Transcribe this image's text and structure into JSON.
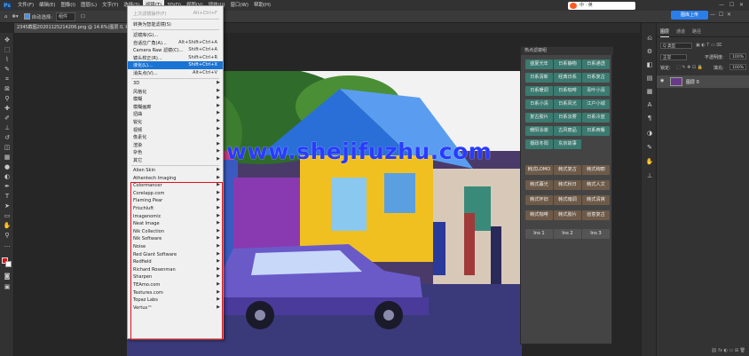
{
  "menubar": {
    "items": [
      "文件(F)",
      "编辑(E)",
      "图像(I)",
      "图层(L)",
      "文字(Y)",
      "选择(S)",
      "滤镜(T)",
      "3D(D)",
      "视图(V)",
      "增效(U)",
      "窗口(W)",
      "帮助(H)"
    ],
    "active_index": 6
  },
  "optionsbar": {
    "auto_select_label": "自动选择:",
    "auto_select_value": "组件"
  },
  "document": {
    "tab_title": "234S截图20201125214206.png @ 14.6%(图层 0, RGB/8#)"
  },
  "filter_menu": {
    "items": [
      {
        "label": "上次滤镜操作(F)",
        "shortcut": "Alt+Ctrl+F",
        "disabled": true
      },
      {
        "sep": true
      },
      {
        "label": "转换为智能滤镜(S)"
      },
      {
        "sep": true
      },
      {
        "label": "滤镜库(G)..."
      },
      {
        "label": "自适应广角(A)...",
        "shortcut": "Alt+Shift+Ctrl+A"
      },
      {
        "label": "Camera Raw 滤镜(C)...",
        "shortcut": "Shift+Ctrl+A"
      },
      {
        "label": "镜头校正(R)...",
        "shortcut": "Shift+Ctrl+R"
      },
      {
        "label": "液化(L)...",
        "shortcut": "Shift+Ctrl+X",
        "highlighted": true
      },
      {
        "label": "消失点(V)...",
        "shortcut": "Alt+Ctrl+V"
      },
      {
        "sep": true
      },
      {
        "label": "3D",
        "submenu": true
      },
      {
        "label": "风格化",
        "submenu": true
      },
      {
        "label": "模糊",
        "submenu": true
      },
      {
        "label": "模糊画廊",
        "submenu": true
      },
      {
        "label": "扭曲",
        "submenu": true
      },
      {
        "label": "锐化",
        "submenu": true
      },
      {
        "label": "视频",
        "submenu": true
      },
      {
        "label": "像素化",
        "submenu": true
      },
      {
        "label": "渲染",
        "submenu": true
      },
      {
        "label": "杂色",
        "submenu": true
      },
      {
        "label": "其它",
        "submenu": true
      },
      {
        "sep": true
      },
      {
        "label": "Alien Skin",
        "submenu": true
      },
      {
        "label": "Athentech Imaging",
        "submenu": true
      },
      {
        "label": "Colormancer",
        "submenu": true
      },
      {
        "label": "Corelapp.com",
        "submenu": true
      },
      {
        "label": "Flaming Pear",
        "submenu": true
      },
      {
        "label": "Frischluft",
        "submenu": true
      },
      {
        "label": "Imagenomic",
        "submenu": true
      },
      {
        "label": "Neat Image",
        "submenu": true
      },
      {
        "label": "Nik Collection",
        "submenu": true
      },
      {
        "label": "Nik Software",
        "submenu": true
      },
      {
        "label": "Noise",
        "submenu": true
      },
      {
        "label": "Red Giant Software",
        "submenu": true
      },
      {
        "label": "Redfield",
        "submenu": true
      },
      {
        "label": "Richard Rosenman",
        "submenu": true
      },
      {
        "label": "Sharpen",
        "submenu": true
      },
      {
        "label": "TEAmo.com",
        "submenu": true
      },
      {
        "label": "Textures.com",
        "submenu": true
      },
      {
        "label": "Topaz Labs",
        "submenu": true
      },
      {
        "label": "Vertus™",
        "submenu": true
      }
    ]
  },
  "watermark": "www.shejifuzhu.com",
  "filter_panel": {
    "title": "热点滤镜组",
    "teal_buttons": [
      "盛夏光年",
      "日系静物",
      "日系通透",
      "日系清新",
      "经典日系",
      "日系复古",
      "日系暖调",
      "日系咖啡",
      "青叶小清",
      "日系小清",
      "日系风光",
      "江户小城",
      "复古胶片",
      "日系淡雾",
      "日系冷蓝",
      "暖阳泳装",
      "古风丽品",
      "日系西餐",
      "摄政冬阳",
      "东京故事"
    ],
    "brown_buttons": [
      "韩式LOMO",
      "韩式复古",
      "韩式绚丽",
      "韩式暮光",
      "韩式秋日",
      "韩式人文",
      "韩式怀旧",
      "韩式暗调",
      "韩式清爽",
      "韩式咖啡",
      "韩式胶片",
      "创意复古"
    ],
    "gray_buttons": [
      "Ins 1",
      "Ins 2",
      "Ins 3"
    ]
  },
  "topright": {
    "upload_label": "图库上传",
    "sogou_label": "中 · 英"
  },
  "layers_panel": {
    "tabs": [
      "图层",
      "通道",
      "路径"
    ],
    "kind_label": "Q 类型",
    "blend_mode": "正常",
    "opacity_label": "不透明度:",
    "opacity_value": "100%",
    "lock_label": "锁定:",
    "fill_label": "填充:",
    "fill_value": "100%",
    "layer_name": "图层 0"
  }
}
